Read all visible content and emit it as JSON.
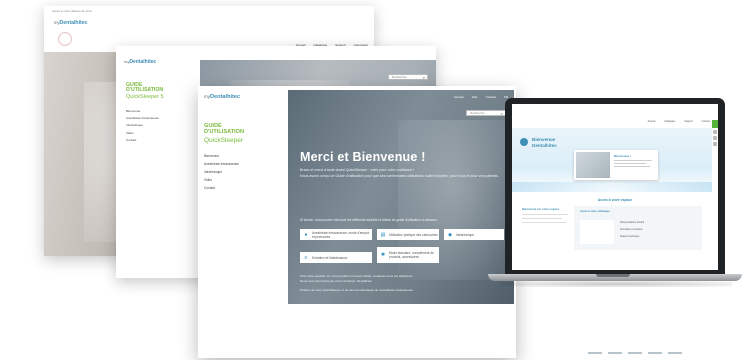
{
  "brand": {
    "logo_prefix": "my",
    "logo_name": "Dentalhitec",
    "primary_color": "#3f8fb4",
    "guide_color": "#7aba3a",
    "action_green": "#55b33b"
  },
  "guide": {
    "title_line1": "GUIDE",
    "title_line2": "D'UTILISATION",
    "subtitle": "QuickSleeper",
    "subtitle_p2": "QuickSleeper 5"
  },
  "nav": [
    "Bienvenue",
    "Anesthésie Intraosseuse",
    "Intraréduque",
    "Vidéo",
    "Contact"
  ],
  "page1": {
    "header_text": "Accès à votre tableau de bord",
    "top_links": [
      "Accueil",
      "Catalogue",
      "Support",
      "Connexion"
    ]
  },
  "page2": {
    "search_placeholder": "Recherche"
  },
  "page3": {
    "search_placeholder": "Recherche",
    "top_links": [
      "Accueil",
      "Aide",
      "Contact",
      "FR"
    ],
    "hero_title": "Merci et Bienvenue !",
    "hero_lines": [
      "Bravo et merci d'avoir choisi QuickSleeper : votre pour votre confiance !",
      "Nous avons conçu ce Guide d'utilisation pour que ses nombreuses utilisations soient simples, pour vous et pour vos patients."
    ],
    "section_intro": "Si besoin, vous pouvez retrouver les différents tutoriels et vidéos du guide d'utilisation ci-dessous.",
    "tiles": [
      {
        "icon": "drop-icon",
        "glyph": "●",
        "label": "Anesthésie intraosseuse, mode d'emploi et protocoles"
      },
      {
        "icon": "document-icon",
        "glyph": "▤",
        "label": "Utilisation pratique des cartouches"
      },
      {
        "icon": "pin-icon",
        "glyph": "◆",
        "label": "Intraréduque"
      },
      {
        "icon": "list-icon",
        "glyph": "≡",
        "label": "Entretien et Maintenance"
      },
      {
        "icon": "gear-icon",
        "glyph": "✱",
        "label": "Mode standard, complément de produits, accessoires"
      }
    ],
    "footer_lines": [
      "Pour toute question sur votre produit ou besoin d'aide, contactez-nous par téléphone",
      "Nous vous remercions de votre confiance. Dentalhitec.",
      "Profitez de votre QuickSleeper et de tous les avantages de l'anesthésie intraosseuse."
    ]
  },
  "laptop": {
    "welcome_line1": "Bienvenue",
    "welcome_line2": "Dentalhitec",
    "welcome_card_title": "Bienvenue !",
    "section_title": "Accès à votre espace",
    "feature_title": "Bienvenue sur votre espace",
    "nav_links": [
      "Accueil",
      "Catalogue",
      "Support",
      "Compte"
    ],
    "list_items": [
      "Accès à votre catalogue",
      "Documentation produit",
      "Formation et tutoriels",
      "Support technique"
    ]
  }
}
